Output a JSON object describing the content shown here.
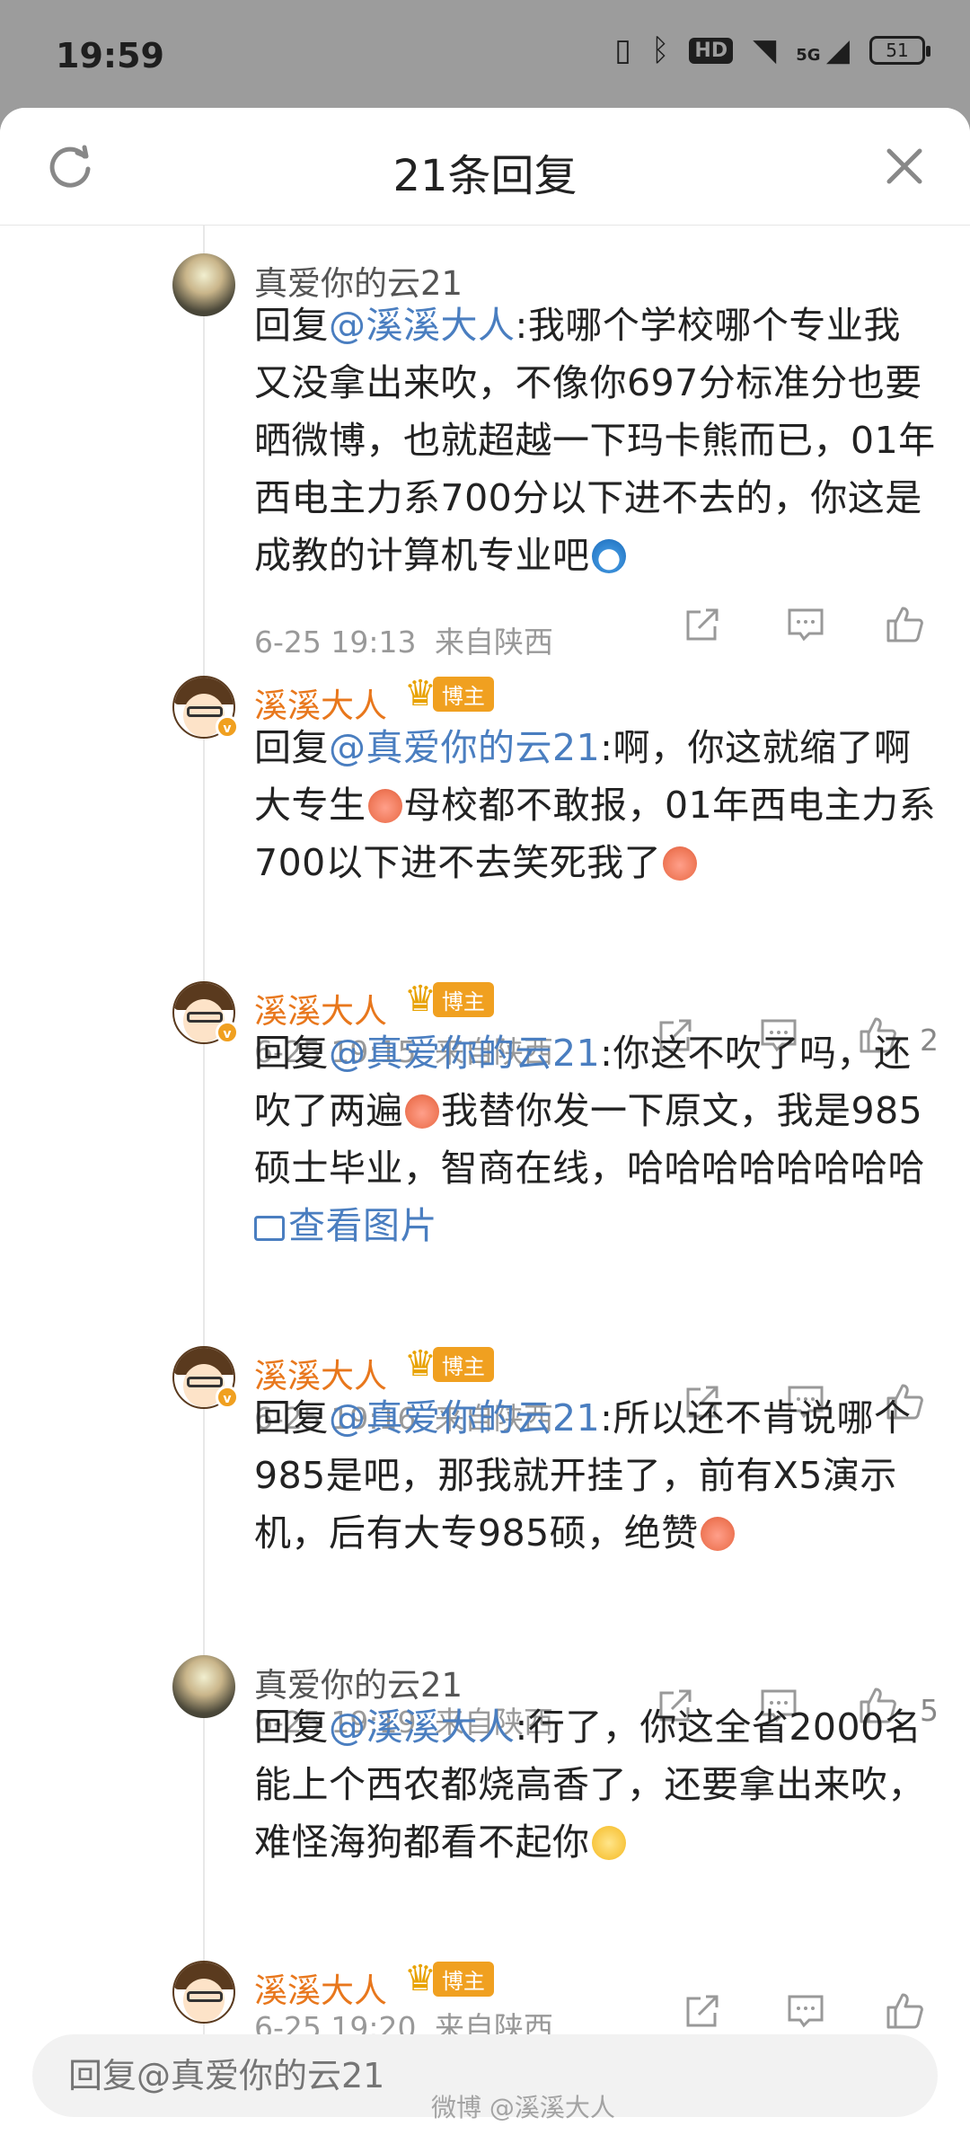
{
  "status_bar": {
    "time": "19:59",
    "hd_label": "HD",
    "network": "5G",
    "battery": "51"
  },
  "header": {
    "title": "21条回复"
  },
  "comments": [
    {
      "user": "真爱你的云21",
      "prefix": "回复",
      "mention": "@溪溪大人",
      "text": ":我哪个学校哪个专业我又没拿出来吹，不像你697分标准分也要晒微博，也就超越一下玛卡熊而已，01年西电主力系700分以下进不去的，你这是成教的计算机专业吧",
      "time": "6-25 19:13",
      "location": "来自陕西",
      "likes": ""
    },
    {
      "user": "溪溪大人",
      "badge": "博主",
      "prefix": "回复",
      "mention": "@真爱你的云21",
      "text_a": ":啊，你这就缩了啊大专生",
      "text_b": "母校都不敢报，01年西电主力系700以下进不去笑死我了",
      "time": "6-25 19:15",
      "location": "来自陕西",
      "likes": "2"
    },
    {
      "user": "溪溪大人",
      "badge": "博主",
      "prefix": "回复",
      "mention": "@真爱你的云21",
      "text_a": ":你这不吹了吗，还吹了两遍",
      "text_b": "我替你发一下原文，我是985硕士毕业，智商在线，哈哈哈哈哈哈哈哈 ",
      "view_image": "查看图片",
      "time": "6-25 19:16",
      "location": "来自陕西",
      "likes": ""
    },
    {
      "user": "溪溪大人",
      "badge": "博主",
      "prefix": "回复",
      "mention": "@真爱你的云21",
      "text": ":所以还不肯说哪个985是吧，那我就开挂了，前有X5演示机，后有大专985硕，绝赞",
      "time": "6-25 19:19",
      "location": "来自陕西",
      "likes": "5"
    },
    {
      "user": "真爱你的云21",
      "prefix": "回复",
      "mention": "@溪溪大人",
      "text": ":行了，你这全省2000名能上个西农都烧高香了，还要拿出来吹，难怪海狗都看不起你",
      "time": "6-25 19:20",
      "location": "来自陕西",
      "likes": ""
    },
    {
      "user": "溪溪大人",
      "badge": "博主"
    }
  ],
  "reply_box": {
    "placeholder": "回复@真爱你的云21"
  },
  "watermark": "微博 @溪溪大人",
  "colors": {
    "mention": "#4a7ec0",
    "blogger_name": "#e8771c",
    "badge": "#f0a020"
  }
}
